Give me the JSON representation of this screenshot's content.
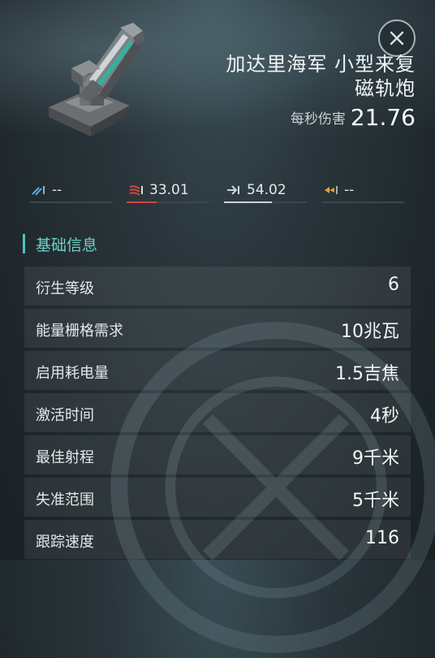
{
  "item": {
    "name_line1": "加达里海军 小型来复",
    "name_line2": "磁轨炮",
    "dps_label": "每秒伤害",
    "dps_value": "21.76"
  },
  "damage_types": [
    {
      "icon": "em-damage-icon",
      "value": "--",
      "color": "#5aa9e6",
      "fill": 0
    },
    {
      "icon": "thermal-damage-icon",
      "value": "33.01",
      "color": "#d9423c",
      "fill": 0.36
    },
    {
      "icon": "kinetic-damage-icon",
      "value": "54.02",
      "color": "#c9d3d7",
      "fill": 0.58
    },
    {
      "icon": "explosive-damage-icon",
      "value": "--",
      "color": "#e0a33a",
      "fill": 0
    }
  ],
  "section": {
    "title": "基础信息"
  },
  "attributes": [
    {
      "label": "衍生等级",
      "value": "6"
    },
    {
      "label": "能量栅格需求",
      "value": "10兆瓦"
    },
    {
      "label": "启用耗电量",
      "value": "1.5吉焦"
    },
    {
      "label": "激活时间",
      "value": "4秒"
    },
    {
      "label": "最佳射程",
      "value": "9千米"
    },
    {
      "label": "失准范围",
      "value": "5千米"
    },
    {
      "label": "跟踪速度",
      "value": "116"
    }
  ],
  "colors": {
    "accent": "#4fc3b6",
    "background": "#2a363c"
  }
}
